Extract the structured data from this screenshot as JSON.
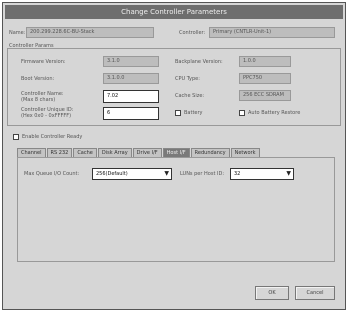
{
  "window": {
    "title": "Change Controller Parameters"
  },
  "top": {
    "name_label": "Name:",
    "name_value": "200.299.228.6C-BU-Stack",
    "controller_label": "Controller:",
    "controller_value": "Primary (CNTLR-Unit-1)"
  },
  "controller_group": {
    "title": "Controller Params",
    "firmware_label": "Firmware Version:",
    "firmware_value": "3.1.0",
    "boot_label": "Boot Version:",
    "boot_value": "3.1.0.0",
    "rate_label": "Controller Name:",
    "rate_sublabel": "(Max 8 chars)",
    "rate_value": "7.02",
    "ctrl_label": "Controller Unique ID:",
    "ctrl_sublabel": "(Hex 0x0 - 0xFFFFF)",
    "ctrl_value": "6",
    "backplane_label": "Backplane Version:",
    "backplane_value": "1.0.0",
    "cpu_label": "CPU Type:",
    "cpu_value": "PPC750",
    "cache_label": "Cache Size:",
    "cache_value": "256 ECC SDRAM",
    "battery_label": "Battery",
    "auto_label": "Auto Battery Restore"
  },
  "enable_label": "Enable Controller Ready",
  "tabs": [
    "Channel",
    "RS 232",
    "Cache",
    "Disk Array",
    "Drive I/F",
    "Host I/F",
    "Redundancy",
    "Network"
  ],
  "active_tab": 5,
  "host_if": {
    "max_queue_label": "Max Queue I/O Count:",
    "max_queue_value": "256(Default)",
    "luns_label": "LUNs per Host ID:",
    "luns_value": "32"
  },
  "buttons": {
    "ok": "OK",
    "cancel": "Cancel"
  }
}
